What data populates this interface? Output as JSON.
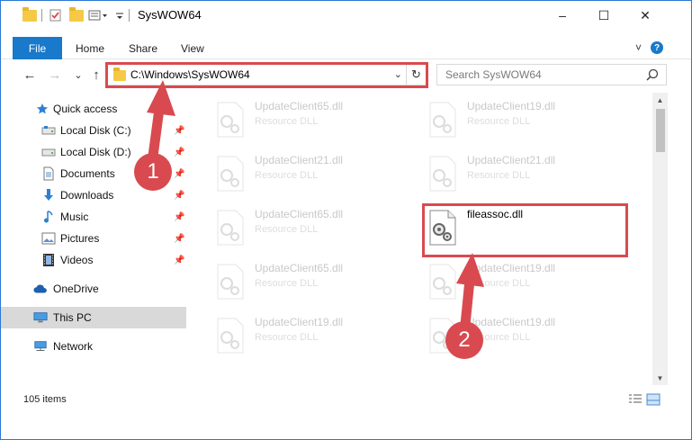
{
  "window": {
    "title": "SysWOW64",
    "controls": {
      "minimize": "–",
      "maximize": "☐",
      "close": "✕"
    }
  },
  "ribbon": {
    "file": "File",
    "tabs": [
      "Home",
      "Share",
      "View"
    ],
    "collapse": "˅",
    "help": "?"
  },
  "navigation": {
    "back": "←",
    "forward": "→",
    "recent": "⌄",
    "up": "↑",
    "address": "C:\\Windows\\SysWOW64",
    "address_dropdown": "⌄",
    "refresh": "↻",
    "search_placeholder": "Search SysWOW64"
  },
  "sidebar": {
    "items": [
      {
        "label": "Quick access",
        "icon": "star-icon",
        "pinned": false
      },
      {
        "label": "Local Disk (C:)",
        "icon": "drive-icon",
        "pinned": true
      },
      {
        "label": "Local Disk (D:)",
        "icon": "drive-icon",
        "pinned": true
      },
      {
        "label": "Documents",
        "icon": "document-icon",
        "pinned": true
      },
      {
        "label": "Downloads",
        "icon": "download-icon",
        "pinned": true
      },
      {
        "label": "Music",
        "icon": "music-icon",
        "pinned": true
      },
      {
        "label": "Pictures",
        "icon": "pictures-icon",
        "pinned": true
      },
      {
        "label": "Videos",
        "icon": "videos-icon",
        "pinned": true
      },
      {
        "label": "OneDrive",
        "icon": "cloud-icon",
        "pinned": false
      },
      {
        "label": "This PC",
        "icon": "computer-icon",
        "pinned": false,
        "selected": true
      },
      {
        "label": "Network",
        "icon": "network-icon",
        "pinned": false
      }
    ]
  },
  "files": [
    {
      "name": "UpdateClient65.dll",
      "type": "Resource DLL",
      "faded": true
    },
    {
      "name": "UpdateClient19.dll",
      "type": "Resource DLL",
      "faded": true
    },
    {
      "name": "UpdateClient21.dll",
      "type": "Resource DLL",
      "faded": true
    },
    {
      "name": "UpdateClient21.dll",
      "type": "Resource DLL",
      "faded": true
    },
    {
      "name": "UpdateClient65.dll",
      "type": "Resource DLL",
      "faded": true
    },
    {
      "name": "fileassoc.dll",
      "type": "",
      "faded": false,
      "highlighted": true
    },
    {
      "name": "UpdateClient65.dll",
      "type": "Resource DLL",
      "faded": true
    },
    {
      "name": "UpdateClient19.dll",
      "type": "Resource DLL",
      "faded": true
    },
    {
      "name": "UpdateClient19.dll",
      "type": "Resource DLL",
      "faded": true
    },
    {
      "name": "UpdateClient19.dll",
      "type": "Resource DLL",
      "faded": true
    }
  ],
  "status": {
    "item_count": "105 items"
  },
  "callouts": [
    {
      "number": "1"
    },
    {
      "number": "2"
    }
  ],
  "colors": {
    "accent": "#1979ca",
    "highlight": "#d84a4f",
    "selected": "#d9d9d9",
    "folder": "#f5c945"
  }
}
